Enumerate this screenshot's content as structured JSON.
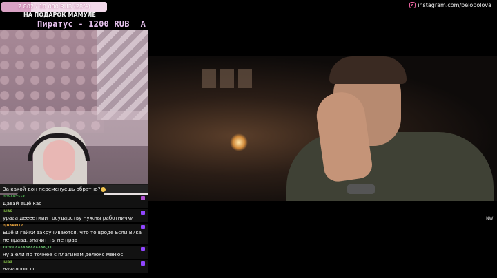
{
  "goal": {
    "label": "2 802 / 10 000 RUB (28%)",
    "progress_fraction": 0.28,
    "caption": "НА ПОДАРОК МАМУЛЕ",
    "fill_color": "#d9a2c4",
    "track_color": "#f2d9ea"
  },
  "donation": {
    "text": "Пиратус - 1200 RUB",
    "extra": "A"
  },
  "instagram": {
    "handle": "instagram.com/belopolova",
    "icon": "instagram-icon",
    "color": "#e8629e"
  },
  "video": {
    "corner_text": "NW"
  },
  "chat": {
    "messages": [
      {
        "user": "",
        "text": "За какой дон переменуешь обратно?",
        "emote": "smile-emote",
        "user_color": "#8fd14f"
      },
      {
        "user": "DOVANYEEK",
        "text": "Давай ещё кас",
        "user_color": "#4caf50",
        "badge_color": "#b050d0"
      },
      {
        "user": "ILIAS",
        "text": "урааа деееетиии государству нужны работнички",
        "user_color": "#7cb342",
        "badge_color": "#9146ff"
      },
      {
        "user": "DJHARKI12",
        "text": "Ещё и гайки закручиваются. Что то вроде Если Вика не права, значит ты не прав",
        "user_color": "#e6a23c",
        "badge_color": "#9146ff"
      },
      {
        "user": "TROOLAAAAAAAAAAAA_11",
        "text": "ну а ели по точнее с плагинам делюкс менюс",
        "user_color": "#66bb6a",
        "badge_color": "#9146ff"
      },
      {
        "user": "ILIAS",
        "text": "началоооссс",
        "user_color": "#7cb342",
        "badge_color": "#9146ff"
      }
    ]
  }
}
